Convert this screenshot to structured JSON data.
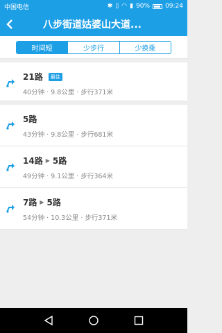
{
  "status": {
    "carrier": "中国电信",
    "battery": "90%",
    "time": "09:24",
    "icons": [
      "bluetooth-icon",
      "vibrate-icon",
      "wifi-icon",
      "signal-4g-icon",
      "battery-icon"
    ]
  },
  "header": {
    "back_icon": "back-chevron-icon",
    "title": "八步街道姑婆山大道..."
  },
  "tabs": [
    {
      "label": "时间短",
      "active": true
    },
    {
      "label": "少步行",
      "active": false
    },
    {
      "label": "少换乘",
      "active": false
    }
  ],
  "routes": [
    {
      "name": [
        "21路"
      ],
      "badge": "最佳",
      "meta": "40分钟 · 9.8公里 · 步行371米"
    },
    {
      "name": [
        "5路"
      ],
      "badge": "",
      "meta": "43分钟 · 9.8公里 · 步行681米"
    },
    {
      "name": [
        "14路",
        "5路"
      ],
      "badge": "",
      "meta": "49分钟 · 9.1公里 · 步行364米"
    },
    {
      "name": [
        "7路",
        "5路"
      ],
      "badge": "",
      "meta": "54分钟 · 10.3公里 · 步行371米"
    }
  ],
  "colors": {
    "accent": "#1d9fe6",
    "background": "#eeeeee"
  },
  "navbar": [
    "back-triangle-icon",
    "home-circle-icon",
    "recent-square-icon"
  ]
}
